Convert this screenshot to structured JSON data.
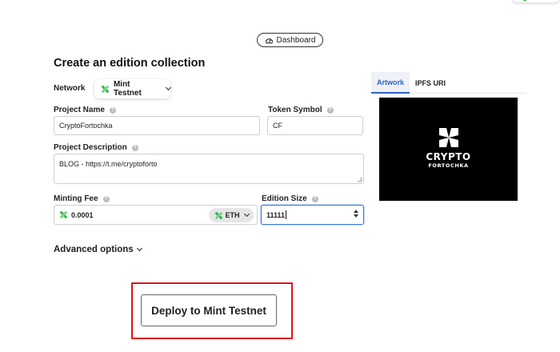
{
  "header": {
    "dashboard_label": "Dashboard"
  },
  "page": {
    "title": "Create an edition collection"
  },
  "network": {
    "label": "Network",
    "selected": "Mint Testnet"
  },
  "project_name": {
    "label": "Project Name",
    "value": "CryptoFortochka"
  },
  "token_symbol": {
    "label": "Token Symbol",
    "value": "CF"
  },
  "project_description": {
    "label": "Project Description",
    "value": "BLOG - https://t.me/cryptoforto"
  },
  "minting_fee": {
    "label": "Minting Fee",
    "value": "0.0001",
    "currency": "ETH"
  },
  "edition_size": {
    "label": "Edition Size",
    "value": "11111"
  },
  "preview": {
    "tabs": [
      {
        "label": "Artwork",
        "active": true
      },
      {
        "label": "IPFS URI",
        "active": false
      }
    ],
    "artwork_text": [
      "CRYPTO",
      "FORTOCHKA"
    ]
  },
  "advanced_options_label": "Advanced options",
  "deploy_button_label": "Deploy to Mint Testnet",
  "colors": {
    "accent": "#2f61c7",
    "highlight": "#e3121e",
    "mint_green": "#2fb34a"
  }
}
